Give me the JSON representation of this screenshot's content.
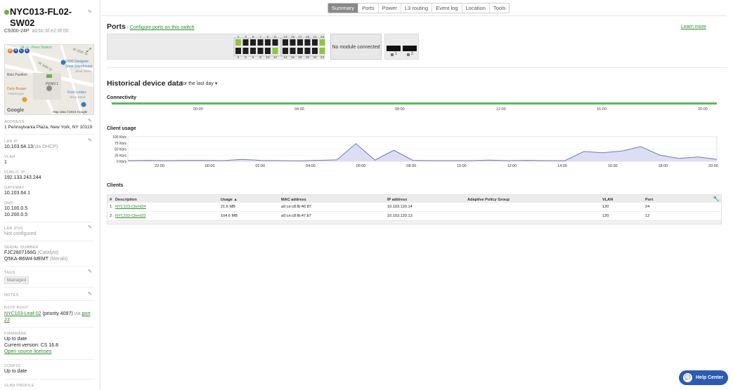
{
  "device": {
    "name": "NYC013-FL02-SW02",
    "model": "C9300-24P",
    "mac": "a0:bc:6f:e2:8f:00",
    "status_color": "#67b346"
  },
  "map": {
    "labels": [
      "34 St - Penn Station",
      "W 35th St",
      "W 34th St",
      "DSW Designer",
      "Shoe Warehouse",
      "Shoe Store",
      "Betz Pavilion",
      "PENN 1",
      "Daily Burger",
      "Hamburger",
      "Foot Locker",
      "Shoe Store",
      "Google",
      "Map data ©2024 Google"
    ],
    "transit": [
      "B",
      "A",
      "C",
      "E"
    ]
  },
  "sidebar": {
    "address_label": "ADDRESS",
    "address": "1 Pennsylvania Plaza, New York, NY 10119",
    "lan_ip_label": "LAN IP",
    "lan_ip": "10.103.64.13",
    "lan_ip_note": "(via DHCP)",
    "vlan_label": "VLAN",
    "vlan": "1",
    "public_ip_label": "PUBLIC IP",
    "public_ip": "192.133.243.244",
    "gateway_label": "GATEWAY",
    "gateway": "10.103.64.1",
    "dns_label": "DNS",
    "dns1": "10.100.0.5",
    "dns2": "10.200.0.5",
    "lan_ipv6_label": "LAN IPV6",
    "lan_ipv6": "Not configured",
    "serial_label": "SERIAL NUMBER",
    "serial1": "FJC2807166G",
    "serial1_note": "(Catalyst)",
    "serial2": "Q5KA-B6W4-MEMT",
    "serial2_note": "(Meraki)",
    "tags_label": "TAGS",
    "tag": "Managed",
    "notes_label": "NOTES",
    "rstp_label": "RSTP ROOT",
    "rstp_link": "NYC103-Leaf-02",
    "rstp_mid": "(priority 4097)",
    "rstp_via": "via",
    "rstp_port": "port",
    "rstp_port2": "23",
    "firmware_label": "FIRMWARE",
    "firmware_status": "Up to date",
    "firmware_version": "Current version: CS 16.8",
    "firmware_link": "Open source licenses",
    "config_label": "CONFIG",
    "config": "Up to date",
    "vlan_profile_label": "VLAN PROFILE"
  },
  "tabs": [
    "Summary",
    "Ports",
    "Power",
    "L3 routing",
    "Event log",
    "Location",
    "Tools"
  ],
  "ports": {
    "title": "Ports",
    "separator": "/",
    "config_link": "Configure ports on this switch",
    "learn_more": "Learn more",
    "top_nums": [
      "1",
      "3",
      "5",
      "7",
      "9",
      "11",
      "13",
      "15",
      "17",
      "19",
      "21",
      "23"
    ],
    "bottom_nums": [
      "2",
      "4",
      "6",
      "8",
      "10",
      "12",
      "14",
      "16",
      "18",
      "20",
      "22",
      "24"
    ],
    "no_module": "No module connected",
    "uplink_nums": [
      "1",
      "2"
    ],
    "active_color": "#8cc63f"
  },
  "history": {
    "title": "Historical device data",
    "range": "for the last day ▾"
  },
  "connectivity": {
    "title": "Connectivity",
    "ticks": [
      "00:00",
      "04:00",
      "08:00",
      "12:00",
      "16:00",
      "20:00"
    ],
    "color": "#5cb85c"
  },
  "chart_data": {
    "type": "area",
    "title": "Client usage",
    "yticks": [
      "100 Kb/s",
      "75 Kb/s",
      "50 Kb/s",
      "25 Kb/s",
      "0 Kb/s"
    ],
    "ylim": [
      0,
      100
    ],
    "x": [
      "22:00",
      "00:00",
      "02:00",
      "04:00",
      "06:00",
      "08:00",
      "10:00",
      "12:00",
      "14:00",
      "16:00",
      "18:00",
      "20:00"
    ],
    "series": [
      {
        "values": [
          3,
          4,
          3,
          4,
          4,
          3,
          8,
          4,
          3,
          2,
          4,
          6,
          72,
          5,
          45,
          4,
          3,
          3,
          3,
          5,
          3,
          4,
          3,
          3,
          40,
          35,
          42,
          60,
          25,
          12,
          18,
          8
        ]
      }
    ],
    "color": "#6c78c8",
    "fill": "#dcdff3"
  },
  "clients": {
    "title": "Clients",
    "columns": [
      "#",
      "Description",
      "Usage ▲",
      "MAC address",
      "IP address",
      "Adaptive Policy Group",
      "VLAN",
      "Port"
    ],
    "rows": [
      [
        "1",
        "NYC103-Client34",
        "21.6 MB",
        "a0:ce:c8:fb:46:87",
        "10.103.120.14",
        "",
        "120",
        "24"
      ],
      [
        "2",
        "NYC103-Client33",
        "104.6 MB",
        "a0:ce:c8:fb:47:b7",
        "10.103.120.13",
        "",
        "120",
        "12"
      ]
    ]
  },
  "help": {
    "label": "Help Center",
    "color": "#2a5bb0"
  }
}
